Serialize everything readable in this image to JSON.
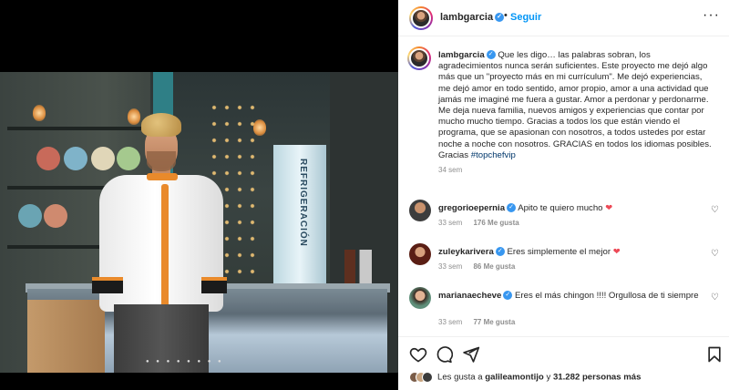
{
  "post": {
    "author": "lambgarcia",
    "follow_label": "Seguir",
    "dot": "•",
    "more_label": "···",
    "caption_user": "lambgarcia",
    "caption_text": "Que les digo… las palabras sobran, los agradecimientos nunca serán suficientes. Este proyecto me dejó algo más que un \"proyecto más en mi currículum\". Me dejó experiencias, me dejó amor en todo sentido, amor propio, amor a una actividad que jamás me imaginé me fuera a gustar. Amor a perdonar y perdonarme. Me deja nueva familia, nuevos amigos y experiencias que contar por mucho mucho tiempo. Gracias a todos los que están viendo el programa, que se apasionan con nosotros, a todos ustedes por estar noche a noche con nosotros. GRACIAS en todos los idiomas posibles. Gracias ",
    "hashtag": "#topchefvip",
    "time": "34 sem"
  },
  "media": {
    "fridge_text": "REFRIGERACIÓN",
    "carousel_dots": "● ● ● ● ● ● ● ●"
  },
  "comments": [
    {
      "user": "gregorioepernia",
      "text": "Apito te quiero mucho ",
      "emoji": "❤",
      "time": "33 sem",
      "likes": "176 Me gusta",
      "reply": ""
    },
    {
      "user": "zuleykarivera",
      "text": "Eres simplemente el mejor ",
      "emoji": "❤",
      "time": "33 sem",
      "likes": "86 Me gusta",
      "reply": ""
    },
    {
      "user": "marianaecheve",
      "text": "Eres el más chingon !!!! Orgullosa de ti siempre",
      "emoji": "",
      "time": "33 sem",
      "likes": "77 Me gusta",
      "reply": ""
    }
  ],
  "likes": {
    "prefix": "Les gusta a ",
    "user": "galileamontijo",
    "middle": " y ",
    "count": "31.282 personas más"
  },
  "colors": {
    "link": "#0095f6",
    "verified": "#3897f0",
    "heart": "#ed4956",
    "accent_orange": "#e98a2b"
  },
  "icons": {
    "actions": [
      "heart-icon",
      "comment-icon",
      "share-icon",
      "bookmark-icon"
    ]
  }
}
